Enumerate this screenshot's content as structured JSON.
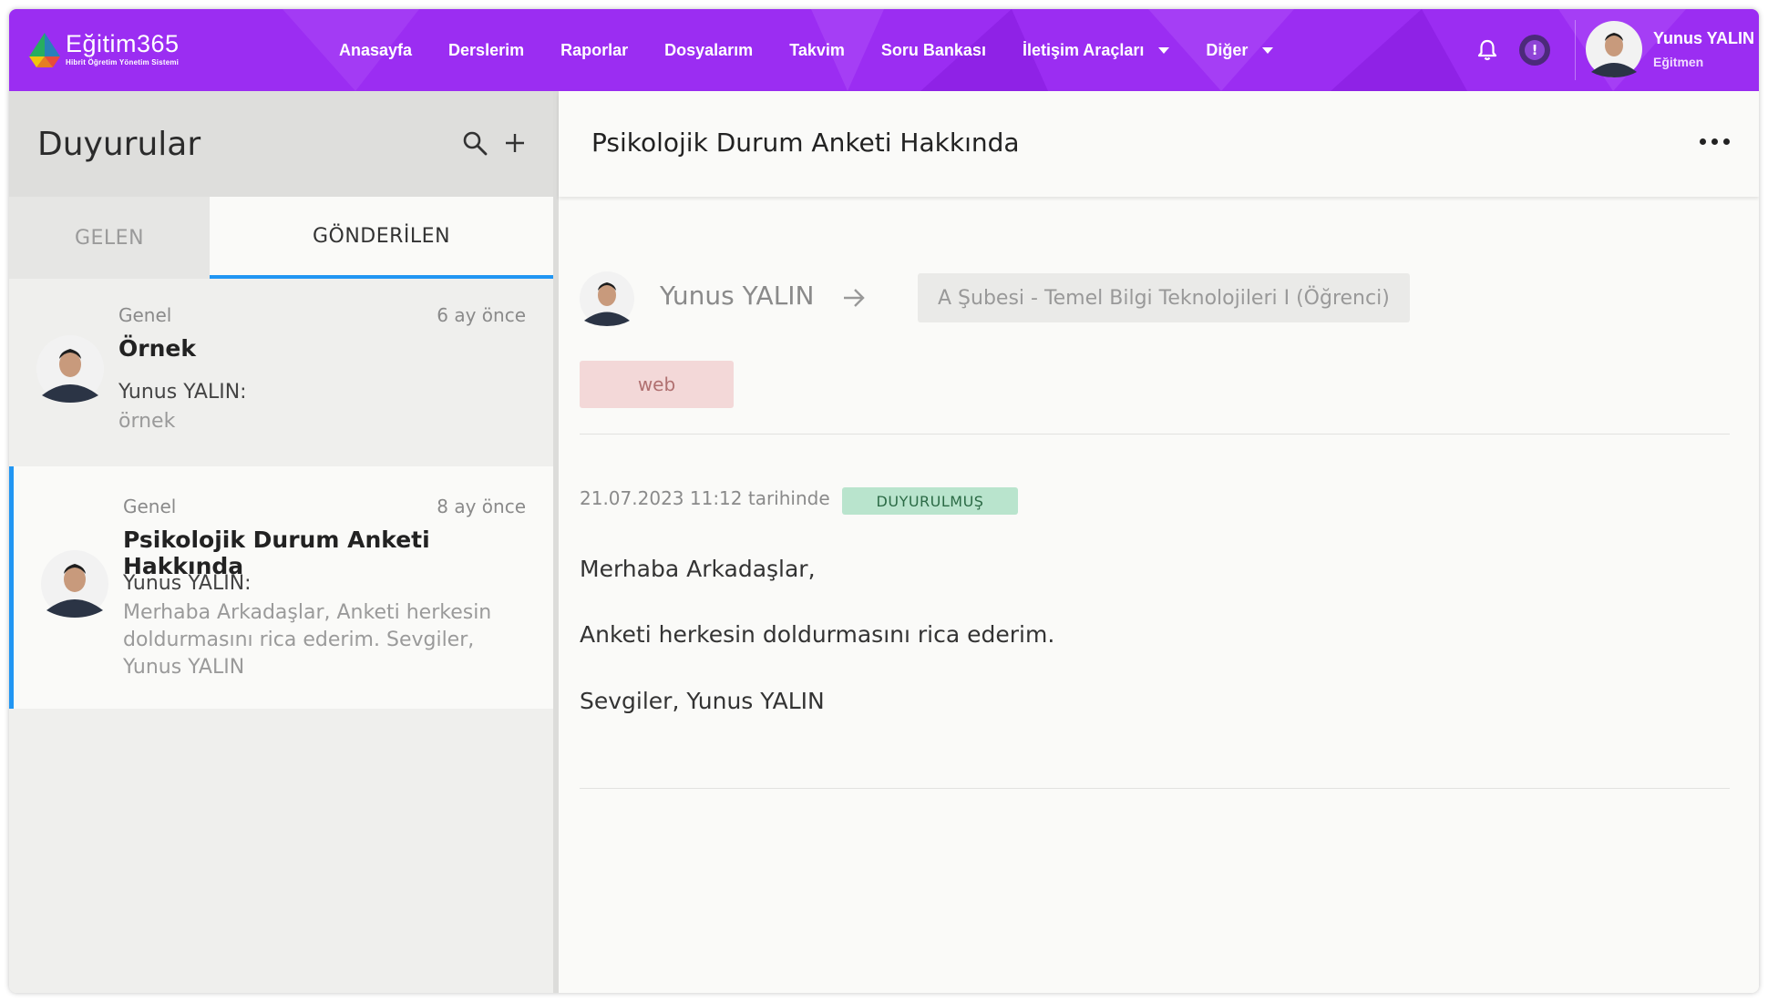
{
  "brand": {
    "name": "Eğitim365",
    "tagline": "Hibrit Öğretim Yönetim Sistemi"
  },
  "nav": {
    "items": [
      {
        "label": "Anasayfa",
        "dropdown": false
      },
      {
        "label": "Derslerim",
        "dropdown": false
      },
      {
        "label": "Raporlar",
        "dropdown": false
      },
      {
        "label": "Dosyalarım",
        "dropdown": false
      },
      {
        "label": "Takvim",
        "dropdown": false
      },
      {
        "label": "Soru Bankası",
        "dropdown": false
      },
      {
        "label": "İletişim Araçları",
        "dropdown": true
      },
      {
        "label": "Diğer",
        "dropdown": true
      }
    ],
    "alert_icon_text": "!"
  },
  "user": {
    "name": "Yunus YALIN",
    "role": "Eğitmen"
  },
  "left_panel": {
    "title": "Duyurular",
    "tabs": {
      "inbox": "GELEN",
      "sent": "GÖNDERİLEN"
    },
    "messages": [
      {
        "category": "Genel",
        "time": "6 ay önce",
        "subject": "Örnek",
        "from": "Yunus YALIN:",
        "preview": [
          "örnek"
        ]
      },
      {
        "category": "Genel",
        "time": "8 ay önce",
        "subject": "Psikolojik Durum Anketi Hakkında",
        "from": "Yunus YALIN:",
        "preview": [
          "Merhaba Arkadaşlar, Anketi herkesin",
          "doldurmasını rica ederim. Sevgiler,",
          "Yunus YALIN"
        ]
      }
    ]
  },
  "detail": {
    "title": "Psikolojik Durum Anketi Hakkında",
    "sender": "Yunus YALIN",
    "recipient": "A Şubesi - Temel Bilgi Teknolojileri I (Öğrenci)",
    "tag": "web",
    "date": "21.07.2023 11:12 tarihinde",
    "status": "DUYURULMUŞ",
    "body": [
      "Merhaba Arkadaşlar,",
      "Anketi herkesin doldurmasını rica ederim.",
      "Sevgiler, Yunus YALIN"
    ]
  },
  "colors": {
    "topbar": "#9b2df2",
    "active_tab_underline": "#2196f3",
    "status_badge_bg": "#b9e4cd",
    "tag_bg": "#f3d8d8"
  },
  "icons": [
    "logo-icon",
    "bell-icon",
    "alert-icon",
    "search-icon",
    "plus-icon",
    "arrow-right-icon",
    "more-icon",
    "chevron-down-icon"
  ]
}
